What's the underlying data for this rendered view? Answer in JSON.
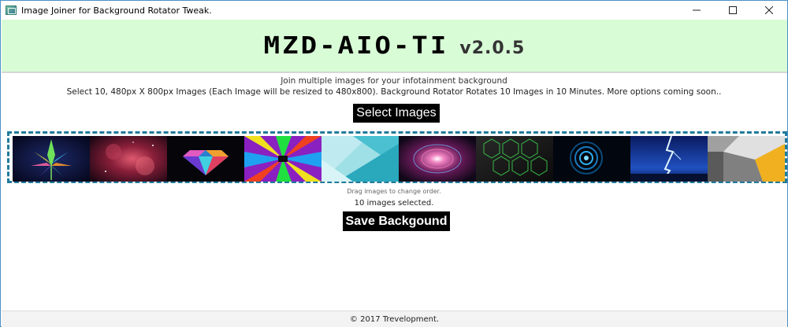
{
  "window": {
    "title": "Image Joiner for Background Rotator Tweak."
  },
  "header": {
    "logo_text": "MZD-AIO-TI",
    "version": "v2.0.5",
    "background_color": "#d8fcd6"
  },
  "intro": {
    "subtitle": "Join multiple images for your infotainment background",
    "description": "Select 10, 480px X 800px Images (Each Image will be resized to 480x800). Background Rotator Rotates 10 Images in 10 Minutes. More options coming soon.."
  },
  "actions": {
    "select_label": "Select Images",
    "save_label": "Save Backgound"
  },
  "gallery": {
    "images": [
      {
        "name": "cannabis-leaf-image"
      },
      {
        "name": "nebula-image"
      },
      {
        "name": "diamond-image"
      },
      {
        "name": "psychedelic-tunnel-image"
      },
      {
        "name": "material-design-image"
      },
      {
        "name": "plasma-burst-image"
      },
      {
        "name": "hexagon-pattern-image"
      },
      {
        "name": "blue-swirl-image"
      },
      {
        "name": "lightning-image"
      },
      {
        "name": "geometric-blocks-image"
      }
    ],
    "hint": "Drag images to change order.",
    "count_text": "10 images selected.",
    "border_color": "#1f7a9a"
  },
  "footer": {
    "copyright": "© 2017 Trevelopment."
  }
}
